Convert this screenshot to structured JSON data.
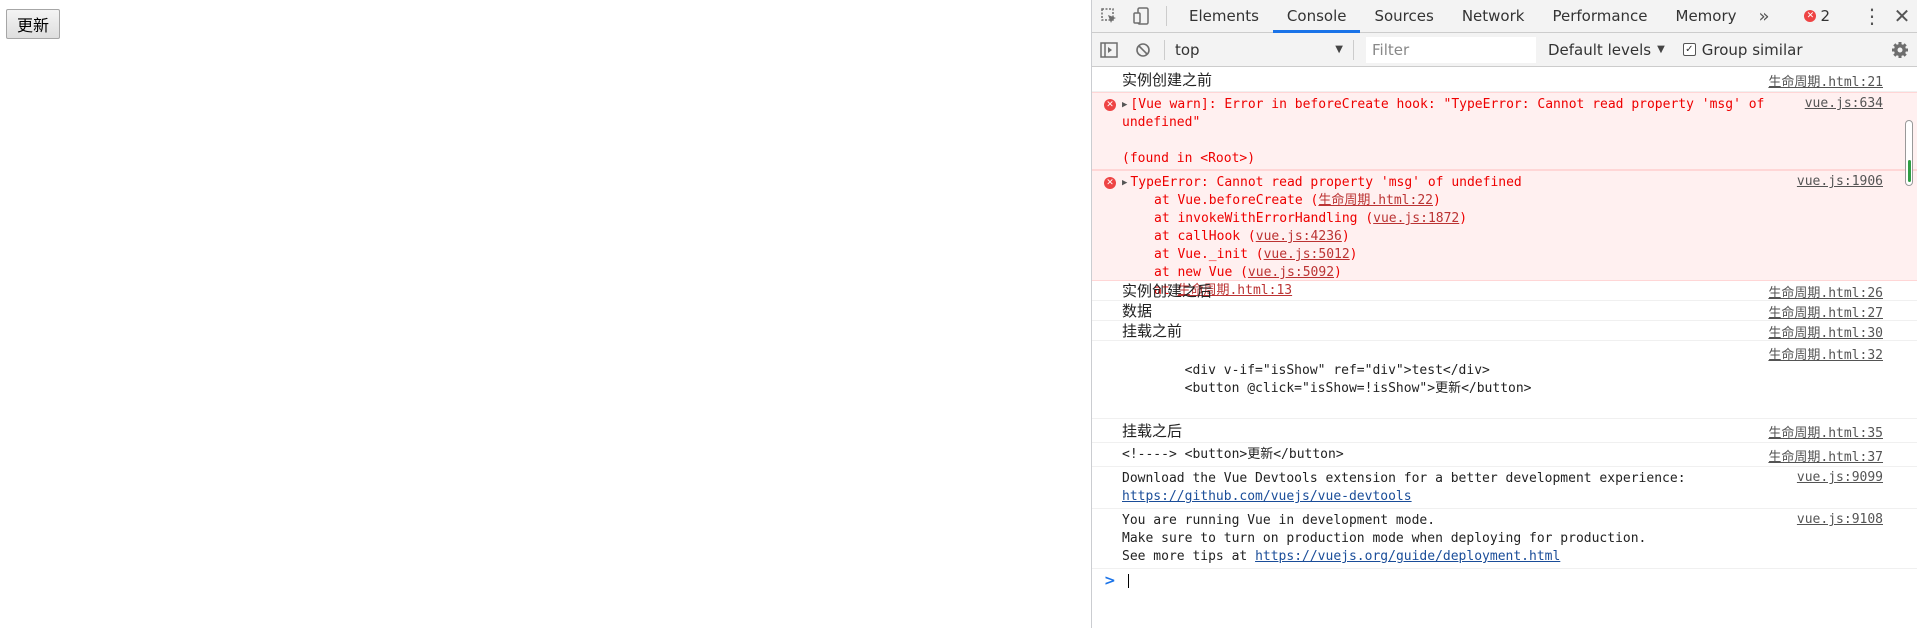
{
  "page": {
    "update_button": "更新"
  },
  "devtools": {
    "tabs": [
      "Elements",
      "Console",
      "Sources",
      "Network",
      "Performance",
      "Memory"
    ],
    "active_tab": "Console",
    "more_tabs": "»",
    "error_count": "2",
    "menu_icon": "kebab-icon",
    "close_icon": "close-icon",
    "console_toolbar": {
      "context": "top",
      "filter_placeholder": "Filter",
      "levels": "Default levels",
      "group_similar": "Group similar",
      "group_similar_checked": true
    },
    "messages": [
      {
        "kind": "log",
        "text": "实例创建之前",
        "source": "生命周期.html:21"
      },
      {
        "kind": "error",
        "text": "[Vue warn]: Error in beforeCreate hook: \"TypeError: Cannot read property 'msg' of undefined\"",
        "text2": "(found in <Root>)",
        "source": "vue.js:634"
      },
      {
        "kind": "error_stack",
        "text": "TypeError: Cannot read property 'msg' of undefined",
        "source": "vue.js:1906",
        "stack": [
          {
            "prefix": "at Vue.beforeCreate (",
            "link": "生命周期.html:22",
            "suffix": ")"
          },
          {
            "prefix": "at invokeWithErrorHandling (",
            "link": "vue.js:1872",
            "suffix": ")"
          },
          {
            "prefix": "at callHook (",
            "link": "vue.js:4236",
            "suffix": ")"
          },
          {
            "prefix": "at Vue._init (",
            "link": "vue.js:5012",
            "suffix": ")"
          },
          {
            "prefix": "at new Vue (",
            "link": "vue.js:5092",
            "suffix": ")"
          },
          {
            "prefix": "at ",
            "link": "生命周期.html:13",
            "suffix": ""
          }
        ]
      },
      {
        "kind": "log",
        "text": "实例创建之后",
        "source": "生命周期.html:26"
      },
      {
        "kind": "log",
        "text": "数据",
        "source": "生命周期.html:27"
      },
      {
        "kind": "log",
        "text": "挂载之前",
        "source": "生命周期.html:30"
      },
      {
        "kind": "code",
        "lines": [
          "",
          "        <div v-if=\"isShow\" ref=\"div\">test</div>",
          "        <button @click=\"isShow=!isShow\">更新</button>",
          ""
        ],
        "source": "生命周期.html:32"
      },
      {
        "kind": "log",
        "text": "挂载之后",
        "source": "生命周期.html:35"
      },
      {
        "kind": "code",
        "lines": [
          "<!----> <button>更新</button>"
        ],
        "source": "生命周期.html:37"
      },
      {
        "kind": "plain",
        "lines": [
          "Download the Vue Devtools extension for a better development experience:"
        ],
        "link": "https://github.com/vuejs/vue-devtools",
        "source": "vue.js:9099"
      },
      {
        "kind": "plain",
        "lines": [
          "You are running Vue in development mode.",
          "Make sure to turn on production mode when deploying for production.",
          "See more tips at "
        ],
        "link": "https://vuejs.org/guide/deployment.html",
        "source": "vue.js:9108"
      }
    ],
    "prompt_symbol": ">"
  }
}
